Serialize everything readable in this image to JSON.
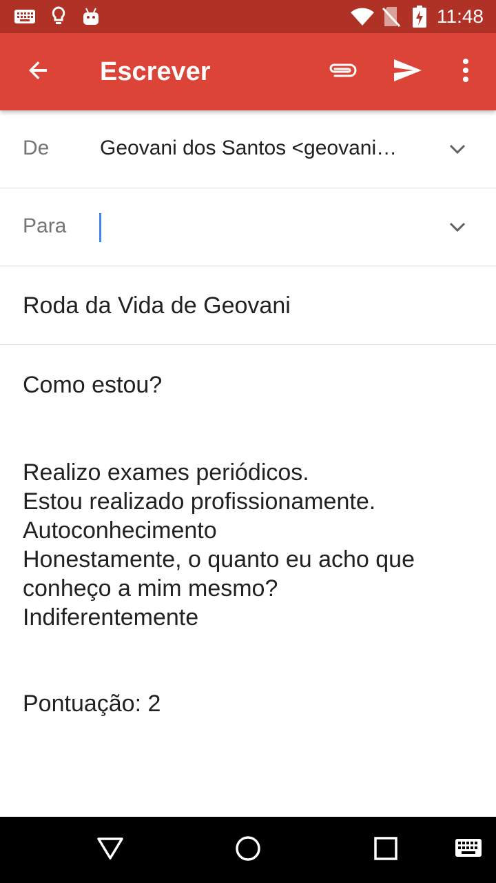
{
  "status_bar": {
    "time": "11:48",
    "icons": [
      "keyboard-icon",
      "lightbulb-icon",
      "android-icon",
      "wifi-icon",
      "no-sim-icon",
      "battery-charging-icon"
    ]
  },
  "toolbar": {
    "title": "Escrever",
    "icons": [
      "back-arrow-icon",
      "attach-icon",
      "send-icon",
      "more-vert-icon"
    ]
  },
  "compose": {
    "from_label": "De",
    "from_value": "Geovani dos Santos  <geovani…",
    "to_label": "Para",
    "to_value": "",
    "subject": "Roda da Vida de Geovani",
    "body": {
      "line1": "Como estou?",
      "paragraph": "Realizo exames periódicos.\nEstou realizado profissionamente.\nAutoconhecimento\nHonestamente, o quanto eu acho que\nconheço a mim mesmo?\nIndiferentemente",
      "score": "Pontuação: 2"
    }
  },
  "nav_bar": {
    "icons": [
      "back-triangle-icon",
      "home-circle-icon",
      "recents-square-icon",
      "keyboard-icon"
    ]
  },
  "colors": {
    "toolbar": "#db4437",
    "status_bar": "#b03125",
    "cursor": "#4285f4"
  }
}
